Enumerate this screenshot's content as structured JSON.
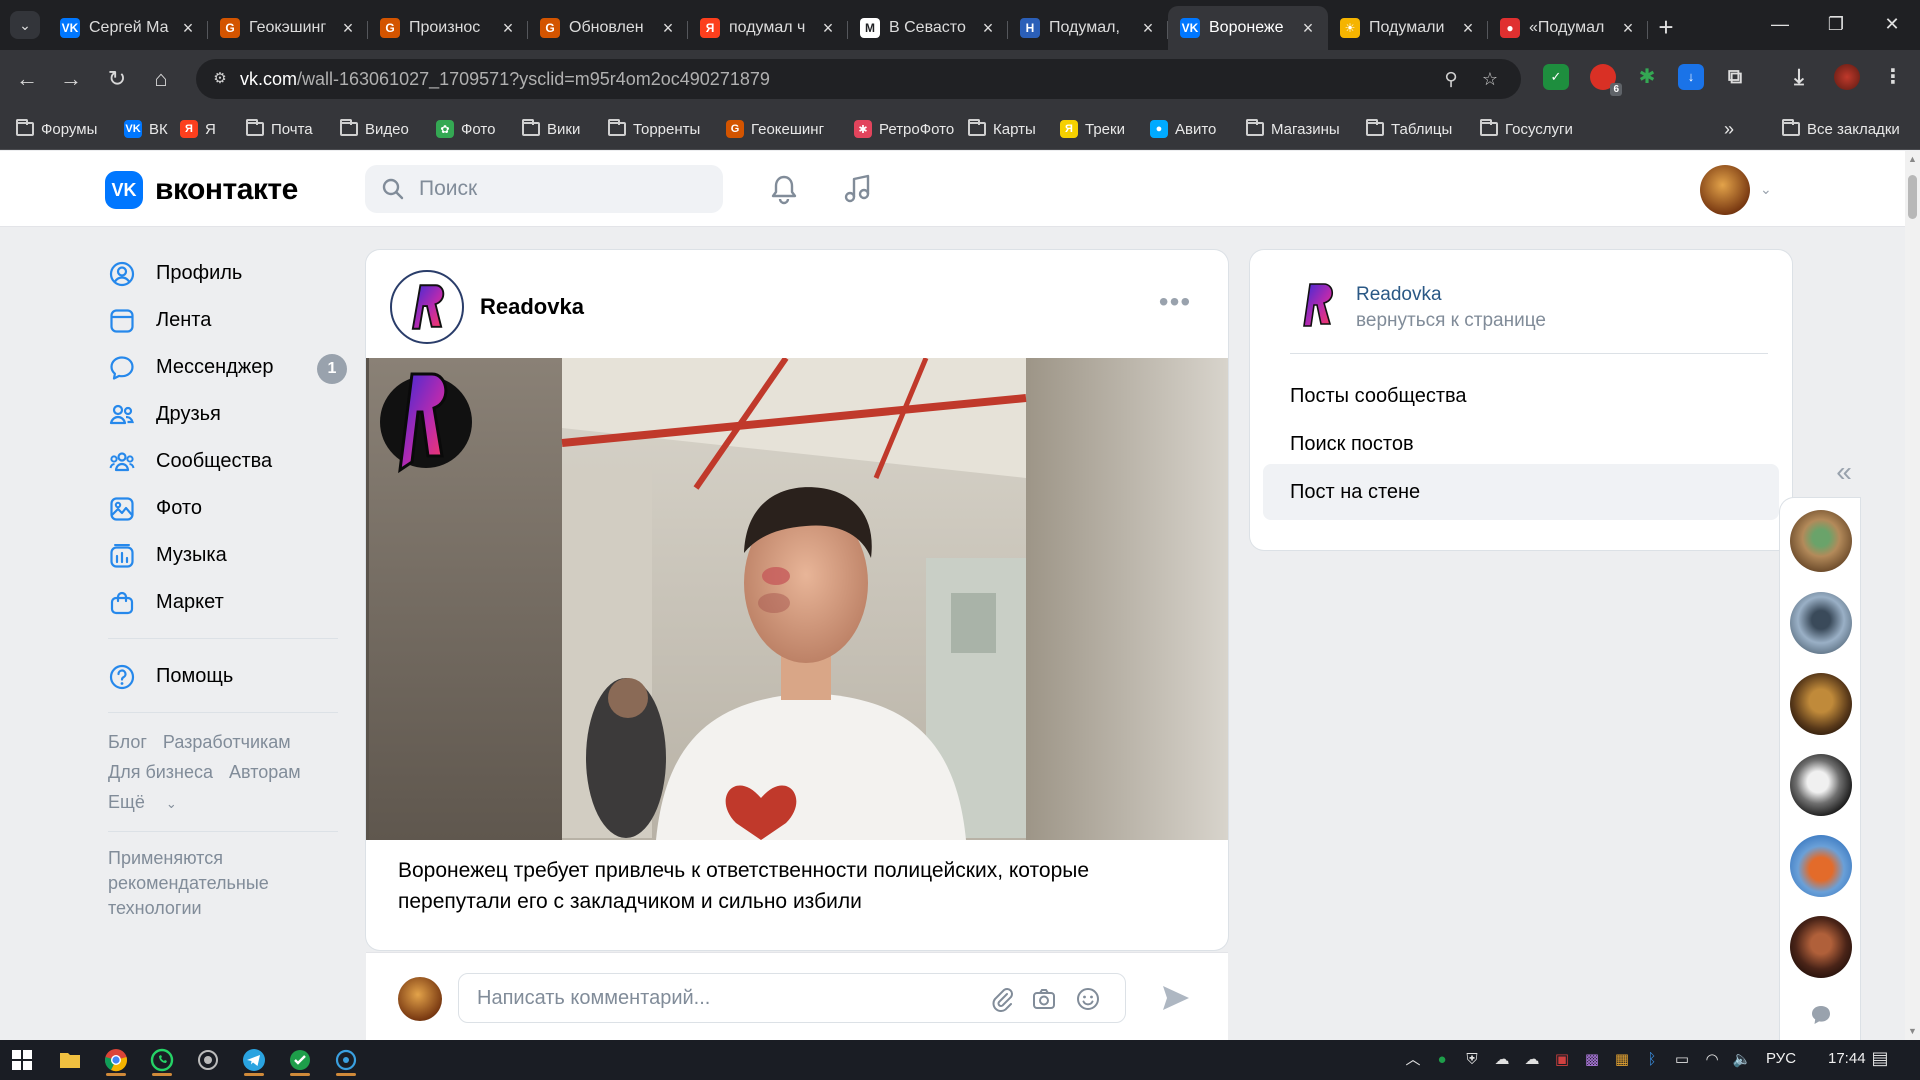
{
  "browser": {
    "tabs": [
      {
        "title": "Сергей Ма",
        "favicon": "vk-icon",
        "color": "#0077ff",
        "glyph": "VK"
      },
      {
        "title": "Геокэшинг",
        "favicon": "geocaching-icon",
        "color": "#d35400",
        "glyph": "G"
      },
      {
        "title": "Произнос",
        "favicon": "geocaching-icon",
        "color": "#d35400",
        "glyph": "G"
      },
      {
        "title": "Обновлен",
        "favicon": "geocaching-icon",
        "color": "#d35400",
        "glyph": "G"
      },
      {
        "title": "подумал ч",
        "favicon": "yandex-icon",
        "color": "#fc3f1d",
        "glyph": "Я"
      },
      {
        "title": "В Севасто",
        "favicon": "news-icon",
        "color": "#ffffff",
        "glyph": "М"
      },
      {
        "title": "Подумал,",
        "favicon": "news-icon",
        "color": "#2b5fb8",
        "glyph": "Н"
      },
      {
        "title": "Воронеже",
        "favicon": "vk-icon",
        "color": "#0077ff",
        "glyph": "VK",
        "active": true
      },
      {
        "title": "Подумали",
        "favicon": "sun-icon",
        "color": "#f5b400",
        "glyph": "☀"
      },
      {
        "title": "«Подумал",
        "favicon": "news-icon",
        "color": "#e03030",
        "glyph": "●"
      }
    ],
    "url_host": "vk.com",
    "url_path": "/wall-163061027_1709571?ysclid=m95r4om2oc490271879",
    "extension_badge": "6",
    "bookmarks": [
      {
        "label": "Форумы",
        "type": "folder"
      },
      {
        "label": "ВК",
        "type": "fav",
        "color": "#0077ff",
        "glyph": "VK"
      },
      {
        "label": "Я",
        "type": "fav",
        "color": "#fc3f1d",
        "glyph": "Я"
      },
      {
        "label": "Почта",
        "type": "folder"
      },
      {
        "label": "Видео",
        "type": "folder"
      },
      {
        "label": "Фото",
        "type": "fav",
        "color": "#34a853",
        "glyph": "✿"
      },
      {
        "label": "Вики",
        "type": "folder"
      },
      {
        "label": "Торренты",
        "type": "folder"
      },
      {
        "label": "Геокешинг",
        "type": "fav",
        "color": "#d35400",
        "glyph": "G"
      },
      {
        "label": "РетроФото",
        "type": "fav",
        "color": "#e2445c",
        "glyph": "✱"
      },
      {
        "label": "Карты",
        "type": "folder"
      },
      {
        "label": "Треки",
        "type": "fav",
        "color": "#f5d000",
        "glyph": "Я"
      },
      {
        "label": "Авито",
        "type": "fav",
        "color": "#00aaff",
        "glyph": "●"
      },
      {
        "label": "Магазины",
        "type": "folder"
      },
      {
        "label": "Таблицы",
        "type": "folder"
      },
      {
        "label": "Госуслуги",
        "type": "folder"
      }
    ],
    "all_bookmarks": "Все закладки"
  },
  "vk": {
    "logo_text": "вконтакте",
    "search_placeholder": "Поиск",
    "nav": [
      {
        "label": "Профиль",
        "icon": "profile-icon"
      },
      {
        "label": "Лента",
        "icon": "feed-icon"
      },
      {
        "label": "Мессенджер",
        "icon": "messenger-icon",
        "badge": "1"
      },
      {
        "label": "Друзья",
        "icon": "friends-icon"
      },
      {
        "label": "Сообщества",
        "icon": "communities-icon"
      },
      {
        "label": "Фото",
        "icon": "photo-icon"
      },
      {
        "label": "Музыка",
        "icon": "music-icon"
      },
      {
        "label": "Маркет",
        "icon": "market-icon"
      }
    ],
    "help": "Помощь",
    "footer": {
      "blog": "Блог",
      "developers": "Разработчикам",
      "business": "Для бизнеса",
      "authors": "Авторам",
      "more": "Ещё"
    },
    "rec_tech": "Применяются рекомендательные технологии",
    "post": {
      "author": "Readovka",
      "text": "Воронежец требует привлечь к ответственности полицейских, которые перепутали его с закладчиком и сильно избили",
      "comment_placeholder": "Написать комментарий..."
    },
    "right_panel": {
      "community_name": "Readovka",
      "back_link": "вернуться к странице",
      "items": [
        "Посты сообщества",
        "Поиск постов",
        "Пост на стене"
      ],
      "active_index": 2
    }
  },
  "taskbar": {
    "lang": "РУС",
    "time": "17:44"
  }
}
